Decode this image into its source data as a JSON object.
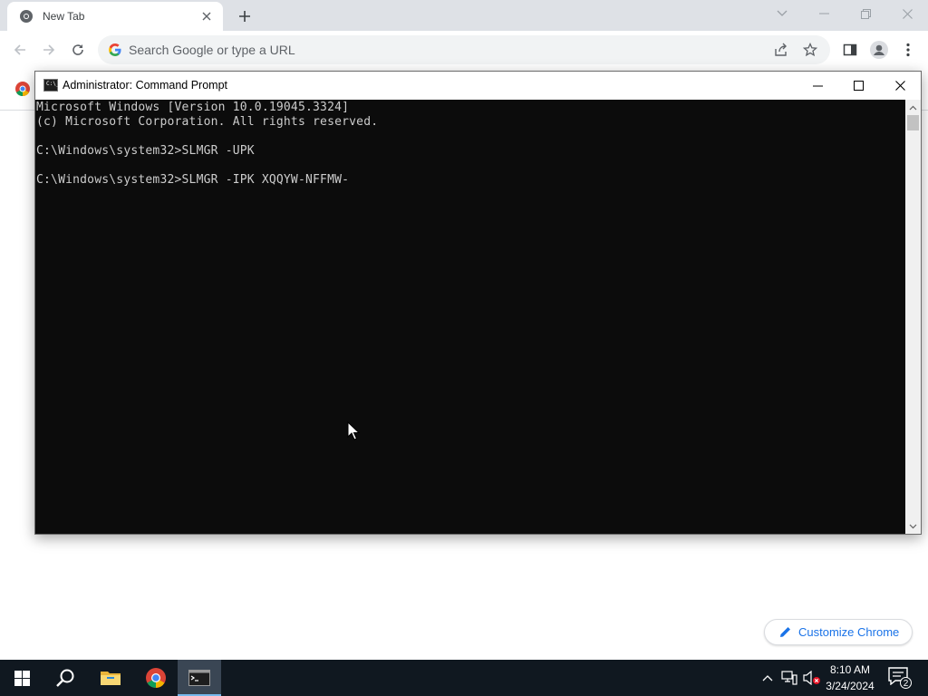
{
  "browser": {
    "tab": {
      "title": "New Tab"
    },
    "omnibox": {
      "placeholder": "Search Google or type a URL"
    },
    "customize_label": "Customize Chrome"
  },
  "cmd": {
    "title": "Administrator: Command Prompt",
    "lines": [
      "Microsoft Windows [Version 10.0.19045.3324]",
      "(c) Microsoft Corporation. All rights reserved.",
      "",
      "C:\\Windows\\system32>SLMGR -UPK",
      "",
      "C:\\Windows\\system32>SLMGR -IPK XQQYW-NFFMW-"
    ],
    "icon_text": "C:\\_",
    "text_color": "#cccccc",
    "background_color": "#0c0c0c"
  },
  "taskbar": {
    "time": "8:10 AM",
    "date": "3/24/2024",
    "notification_count": "2",
    "pinned": [
      "start-icon",
      "search-icon",
      "file-explorer-icon",
      "chrome-icon",
      "command-prompt-icon"
    ]
  },
  "colors": {
    "accent": "#1a73e8",
    "taskbar": "#101820",
    "tabstrip": "#dee1e6"
  }
}
